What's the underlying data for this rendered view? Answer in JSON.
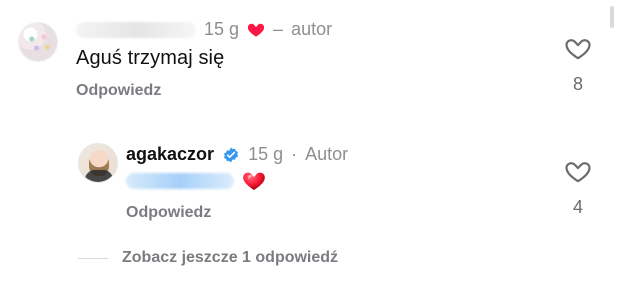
{
  "comments": [
    {
      "username": "",
      "time": "15 g",
      "separator": "–",
      "role": "autor",
      "text": "Aguś trzymaj się",
      "reply_label": "Odpowiedz",
      "likes": "8",
      "icons": {
        "author_reaction": "heart-filled-red",
        "like": "heart-outline"
      }
    }
  ],
  "reply": {
    "username": "agakaczor",
    "time": "15 g",
    "dot": "·",
    "role": "Autor",
    "mention_text": "",
    "reply_label": "Odpowiedz",
    "likes": "4",
    "icons": {
      "verified": "verified-badge",
      "heart": "heart-3d",
      "like": "heart-outline"
    }
  },
  "more_replies": {
    "label": "Zobacz jeszcze 1 odpowiedź"
  },
  "colors": {
    "accent_blue": "#3897F0",
    "text_primary": "#111111",
    "text_secondary": "#8E8E93",
    "reply_link": "#7B7B80",
    "like_count": "#6B6B70",
    "heart_red": "#FF1744",
    "divider": "#D7D7DC"
  }
}
